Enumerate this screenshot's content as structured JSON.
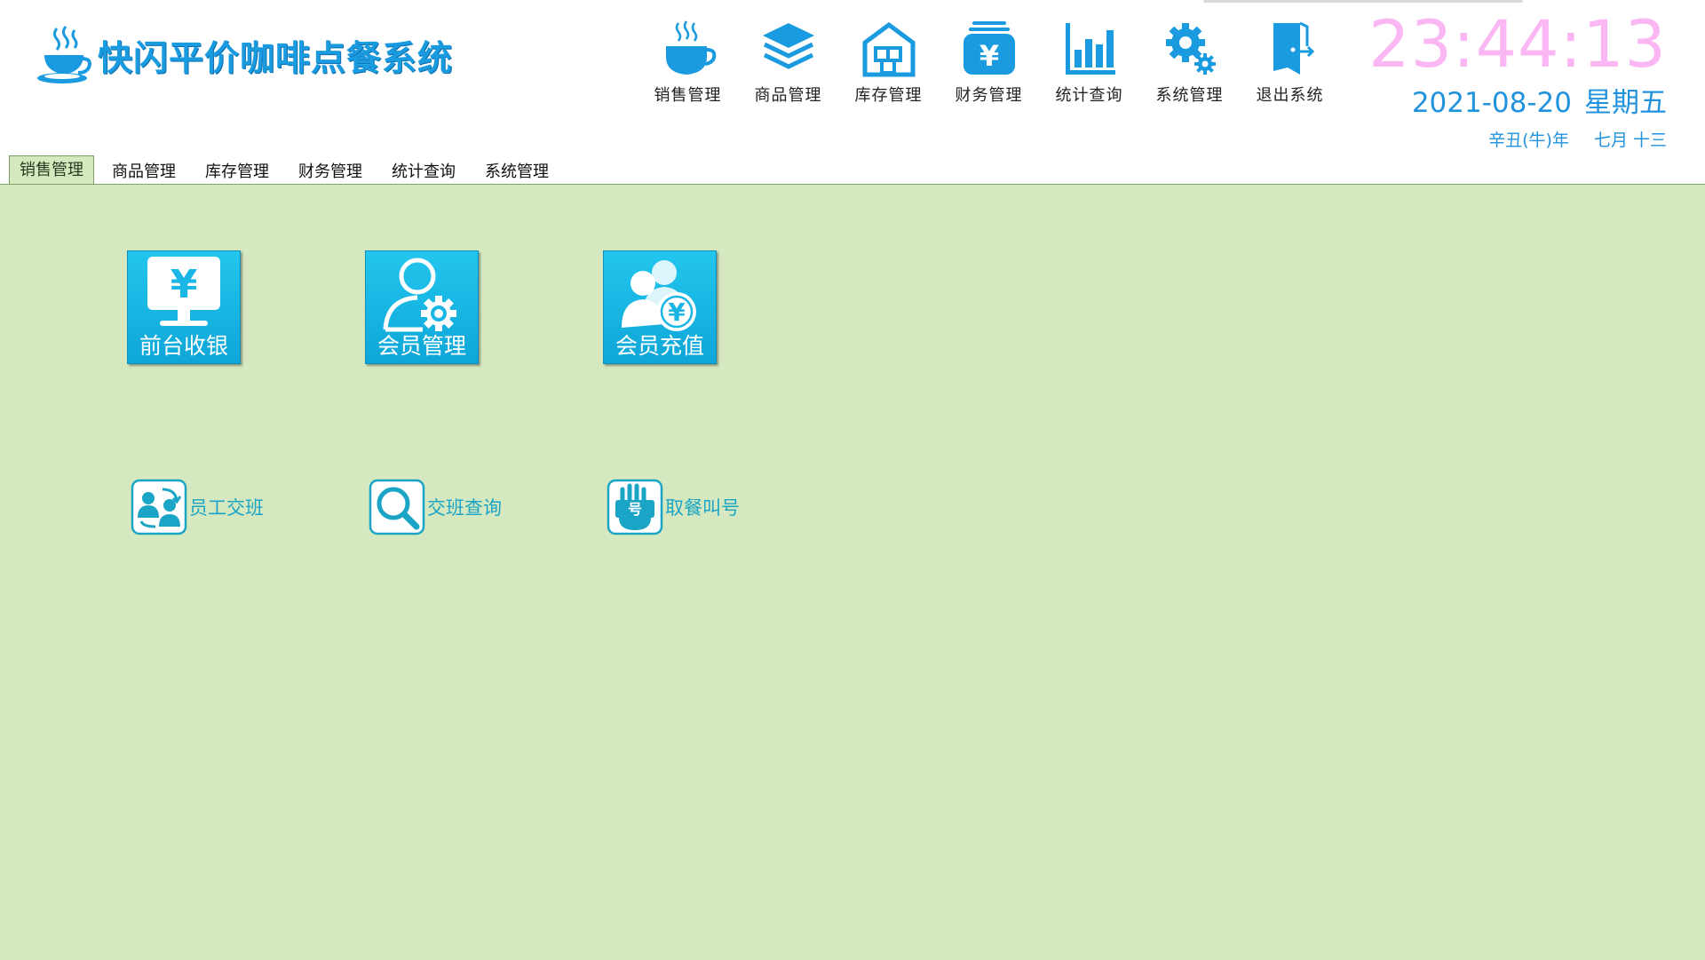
{
  "app": {
    "title": "快闪平价咖啡点餐系统"
  },
  "top_nav": [
    {
      "label": "销售管理",
      "icon": "coffee-cup-icon"
    },
    {
      "label": "商品管理",
      "icon": "layers-icon"
    },
    {
      "label": "库存管理",
      "icon": "warehouse-icon"
    },
    {
      "label": "财务管理",
      "icon": "yuan-bag-icon"
    },
    {
      "label": "统计查询",
      "icon": "bar-chart-icon"
    },
    {
      "label": "系统管理",
      "icon": "gear-icon"
    },
    {
      "label": "退出系统",
      "icon": "exit-door-icon"
    }
  ],
  "clock": {
    "time": "23:44:13",
    "date": "2021-08-20",
    "weekday": "星期五",
    "lunar_year": "辛丑(牛)年",
    "lunar_day": "七月 十三"
  },
  "tabs": [
    {
      "label": "销售管理",
      "active": true
    },
    {
      "label": "商品管理"
    },
    {
      "label": "库存管理"
    },
    {
      "label": "财务管理"
    },
    {
      "label": "统计查询"
    },
    {
      "label": "系统管理"
    }
  ],
  "tiles": [
    {
      "label": "前台收银",
      "icon": "cashier-monitor-icon"
    },
    {
      "label": "会员管理",
      "icon": "member-settings-icon"
    },
    {
      "label": "会员充值",
      "icon": "member-recharge-icon"
    }
  ],
  "small_items": [
    {
      "label": "员工交班",
      "icon": "staff-handover-icon"
    },
    {
      "label": "交班查询",
      "icon": "magnifier-icon"
    },
    {
      "label": "取餐叫号",
      "icon": "number-call-icon"
    }
  ],
  "colors": {
    "brand_blue": "#1a9be0",
    "tile_blue": "#19b6e6",
    "content_bg": "#d6e8bf",
    "clock_pink": "#fbb7f4",
    "date_blue": "#2192dd",
    "small_label": "#1aa5c6"
  }
}
